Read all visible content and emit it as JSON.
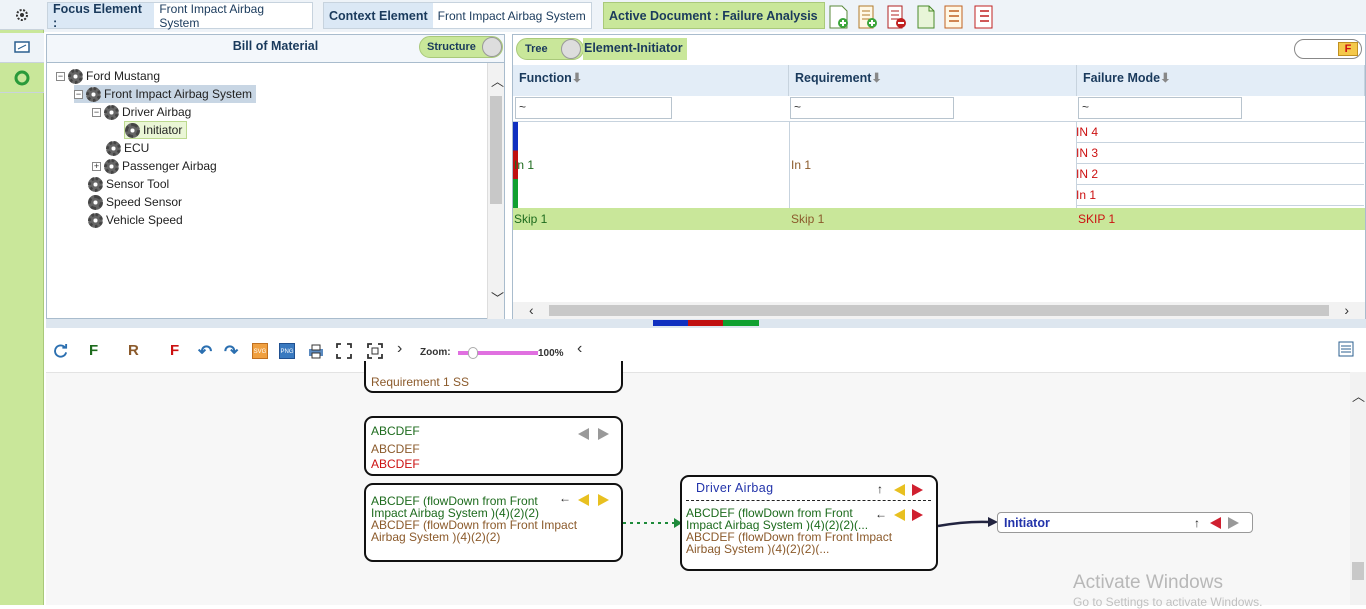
{
  "topbar": {
    "focus_label": "Focus Element :",
    "focus_value": "Front Impact Airbag System",
    "context_label": "Context Element",
    "context_value": "Front Impact Airbag System",
    "active_doc": "Active Document : Failure Analysis"
  },
  "bom": {
    "title": "Bill of Material",
    "toggle_label": "Structure",
    "tree": [
      {
        "label": "Ford Mustang"
      },
      {
        "label": "Front Impact Airbag System"
      },
      {
        "label": "Driver Airbag"
      },
      {
        "label": "Initiator"
      },
      {
        "label": "ECU"
      },
      {
        "label": "Passenger Airbag"
      },
      {
        "label": "Sensor Tool"
      },
      {
        "label": "Speed Sensor"
      },
      {
        "label": "Vehicle Speed"
      }
    ]
  },
  "req": {
    "toggle_label": "Tree",
    "view_label": "Element-Initiator",
    "filter_badge": "F",
    "columns": [
      "Function",
      "Requirement",
      "Failure Mode"
    ],
    "filters": [
      "~",
      "~",
      "~"
    ],
    "rows": [
      {
        "function": "In 1",
        "requirement": "In 1",
        "failure_modes": [
          "IN 4",
          "IN 3",
          "IN 2",
          "In 1"
        ]
      },
      {
        "function": "Skip 1",
        "requirement": "Skip 1",
        "failure_modes": [
          "SKIP 1"
        ]
      }
    ]
  },
  "graph_toolbar": {
    "f1": "F",
    "r": "R",
    "f2": "F",
    "zoom_label": "Zoom:",
    "zoom_value": "100%"
  },
  "graph": {
    "node_top": {
      "text": "Requirement 1 SS"
    },
    "node2": {
      "line1": "ABCDEF",
      "line2": "ABCDEF",
      "line3": "ABCDEF"
    },
    "node3": {
      "line1": "ABCDEF (flowDown from Front Impact Airbag System )(4)(2)(2)",
      "line2": "ABCDEF (flowDown from Front Impact Airbag System )(4)(2)(2)"
    },
    "node_driver": {
      "title": "Driver Airbag",
      "line1": "ABCDEF (flowDown from Front Impact Airbag System )(4)(2)(2)(...",
      "line2": "ABCDEF (flowDown from Front Impact Airbag System )(4)(2)(2)(..."
    },
    "node_init": {
      "title": "Initiator"
    }
  },
  "watermark": {
    "line1": "Activate Windows",
    "line2": "Go to Settings to activate Windows."
  }
}
